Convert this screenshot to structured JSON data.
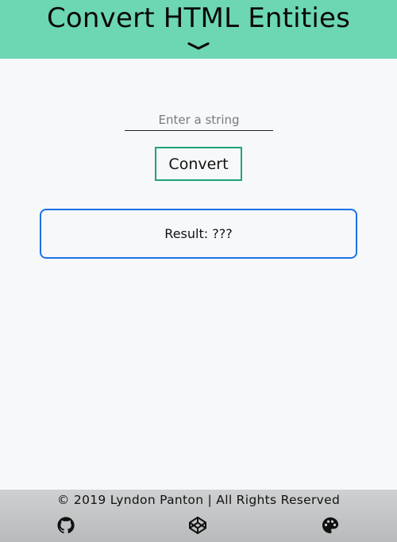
{
  "header": {
    "title": "Convert HTML Entities",
    "toggle_icon": "chevron-down-icon",
    "background_color": "#6dd6b3"
  },
  "form": {
    "input": {
      "value": "",
      "placeholder": "Enter a string"
    },
    "convert_label": "Convert",
    "button_border_color": "#1fa27a"
  },
  "result": {
    "label": "Result:",
    "value": "???",
    "border_color": "#1a73e8"
  },
  "footer": {
    "copyright": "© 2019 Lyndon Panton | All Rights Reserved",
    "links": [
      {
        "icon": "github-icon"
      },
      {
        "icon": "codepen-icon"
      },
      {
        "icon": "palette-icon"
      }
    ]
  }
}
